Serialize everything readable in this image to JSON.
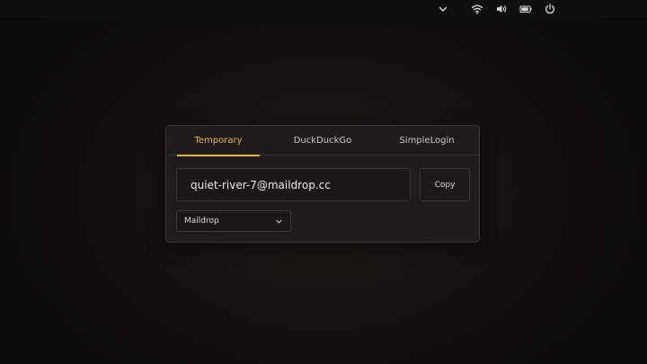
{
  "system_tray": {
    "icons": [
      "chevron-down-icon",
      "wifi-icon",
      "volume-icon",
      "battery-icon",
      "power-icon"
    ]
  },
  "tabs": [
    {
      "label": "Temporary",
      "active": true
    },
    {
      "label": "DuckDuckGo",
      "active": false
    },
    {
      "label": "SimpleLogin",
      "active": false
    }
  ],
  "address": {
    "value": "quiet-river-7@maildrop.cc"
  },
  "copy_button": {
    "label": "Copy"
  },
  "provider_select": {
    "selected": "Maildrop"
  },
  "colors": {
    "accent": "#e9b34f",
    "card_bg": "#1e1d1b",
    "text": "#ecebe8"
  }
}
